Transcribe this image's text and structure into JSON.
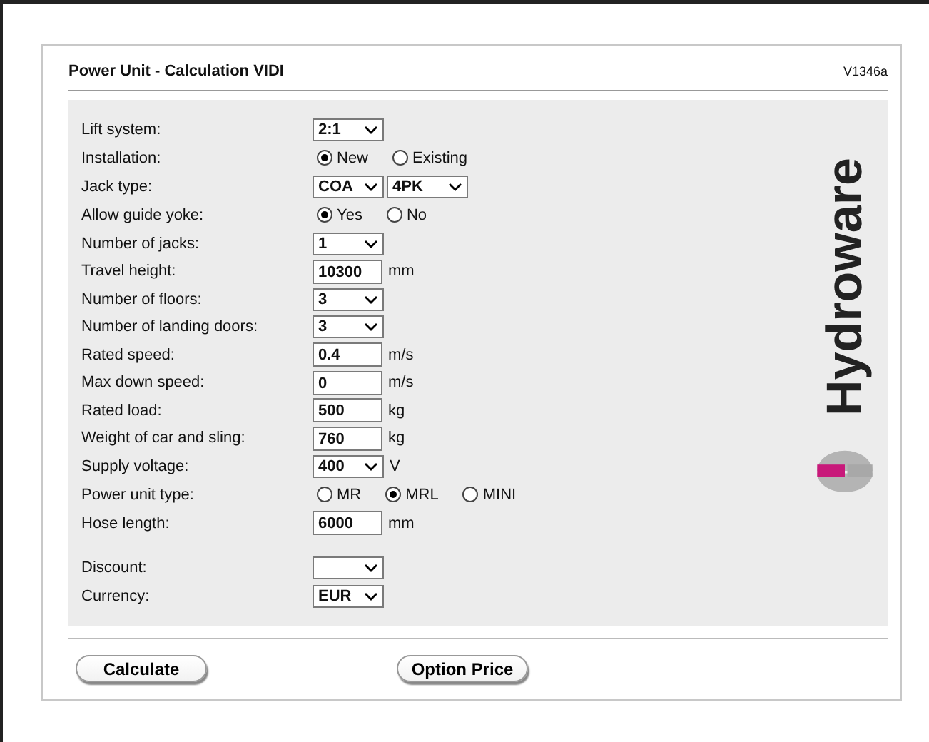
{
  "title": "Power Unit - Calculation VIDI",
  "version": "V1346a",
  "rows": [
    {
      "label": "Lift system:",
      "controls": [
        {
          "kind": "select",
          "value": "2:1"
        }
      ]
    },
    {
      "label": "Installation:",
      "controls": [
        {
          "kind": "radio",
          "label": "New",
          "selected": true
        },
        {
          "kind": "radio",
          "label": "Existing",
          "selected": false
        }
      ]
    },
    {
      "label": "Jack type:",
      "controls": [
        {
          "kind": "select",
          "value": "COA"
        },
        {
          "kind": "select",
          "value": "4PK"
        }
      ]
    },
    {
      "label": "Allow guide yoke:",
      "controls": [
        {
          "kind": "radio",
          "label": "Yes",
          "selected": true
        },
        {
          "kind": "radio",
          "label": "No",
          "selected": false
        }
      ]
    },
    {
      "label": "Number of jacks:",
      "controls": [
        {
          "kind": "select",
          "value": "1"
        }
      ]
    },
    {
      "label": "Travel height:",
      "controls": [
        {
          "kind": "input",
          "value": "10300"
        },
        {
          "kind": "unit",
          "text": "mm"
        }
      ]
    },
    {
      "label": "Number of floors:",
      "controls": [
        {
          "kind": "select",
          "value": "3"
        }
      ]
    },
    {
      "label": "Number of landing doors:",
      "controls": [
        {
          "kind": "select",
          "value": "3"
        }
      ]
    },
    {
      "label": "Rated speed:",
      "controls": [
        {
          "kind": "input",
          "value": "0.4"
        },
        {
          "kind": "unit",
          "text": "m/s"
        }
      ]
    },
    {
      "label": "Max down speed:",
      "controls": [
        {
          "kind": "input",
          "value": "0"
        },
        {
          "kind": "unit",
          "text": "m/s"
        }
      ]
    },
    {
      "label": "Rated load:",
      "controls": [
        {
          "kind": "input",
          "value": "500"
        },
        {
          "kind": "unit",
          "text": "kg"
        }
      ]
    },
    {
      "label": "Weight of car and sling:",
      "controls": [
        {
          "kind": "input",
          "value": "760"
        },
        {
          "kind": "unit",
          "text": "kg"
        }
      ]
    },
    {
      "label": "Supply voltage:",
      "controls": [
        {
          "kind": "select",
          "value": "400"
        },
        {
          "kind": "unit",
          "text": "V"
        }
      ]
    },
    {
      "label": "Power unit type:",
      "controls": [
        {
          "kind": "radio",
          "label": "MR",
          "selected": false
        },
        {
          "kind": "radio",
          "label": "MRL",
          "selected": true
        },
        {
          "kind": "radio",
          "label": "MINI",
          "selected": false
        }
      ]
    },
    {
      "label": "Hose length:",
      "controls": [
        {
          "kind": "input",
          "value": "6000"
        },
        {
          "kind": "unit",
          "text": "mm"
        }
      ]
    }
  ],
  "pricing_rows": [
    {
      "label": "Discount:",
      "controls": [
        {
          "kind": "select"
        }
      ]
    },
    {
      "label": "Currency:",
      "controls": [
        {
          "kind": "select",
          "value": "EUR"
        }
      ]
    }
  ],
  "logo": {
    "text": "Hydroware"
  },
  "buttons": [
    "Calculate",
    "Option Price"
  ]
}
